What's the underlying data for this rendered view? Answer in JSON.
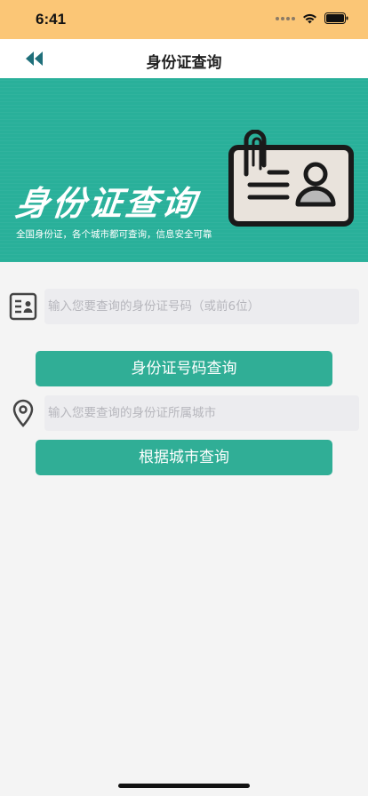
{
  "status_bar": {
    "time": "6:41",
    "background": "#fbc676"
  },
  "nav": {
    "title": "身份证查询",
    "back_icon": "double-chevron-left-icon",
    "back_icon_color": "#1f6f7a"
  },
  "banner": {
    "title": "身份证查询",
    "subtitle": "全国身份证，各个城市都可查询，信息安全可靠",
    "background": "#29b09a",
    "illustration": "id-card-icon"
  },
  "id_search": {
    "icon": "id-card-icon",
    "placeholder": "输入您要查询的身份证号码（或前6位）",
    "button_label": "身份证号码查询"
  },
  "city_search": {
    "icon": "location-pin-icon",
    "placeholder": "输入您要查询的身份证所属城市",
    "button_label": "根据城市查询"
  },
  "colors": {
    "accent": "#30ae96",
    "page_background": "#f4f4f4",
    "input_background": "#ececef"
  }
}
